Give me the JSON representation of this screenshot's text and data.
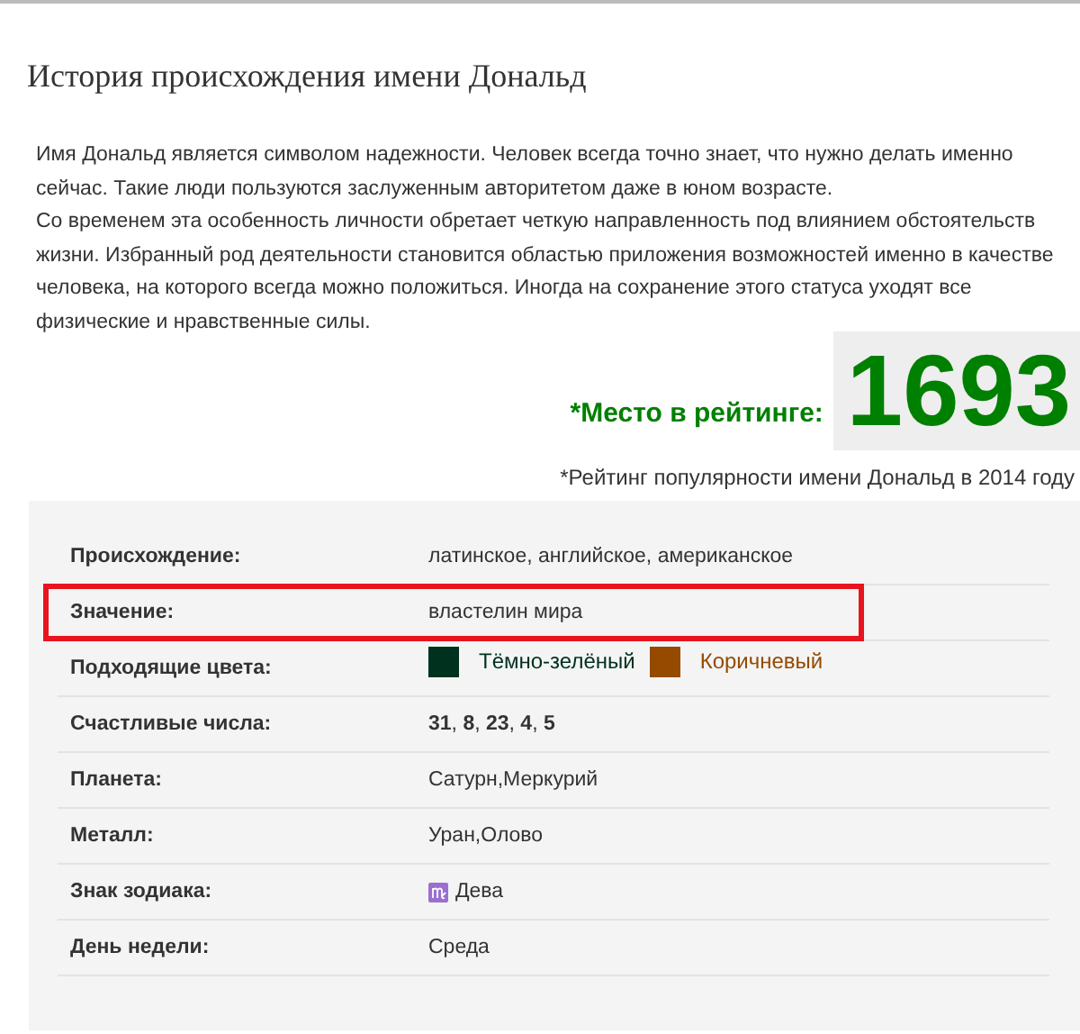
{
  "title": "История происхождения имени Дональд",
  "paragraphs": [
    "Имя Дональд является символом надежности. Человек всегда точно знает, что нужно делать именно сейчас. Такие люди пользуются заслуженным авторитетом даже в юном возрасте.",
    "Со временем эта особенность личности обретает четкую направленность под влиянием обстоятельств жизни. Избранный род деятельности становится областью приложения возможностей именно в качестве человека, на которого всегда можно положиться. Иногда на сохранение этого статуса уходят все физические и нравственные силы."
  ],
  "rating": {
    "label": "*Место в рейтинге:",
    "value": "1693",
    "note": "*Рейтинг популярности имени Дональд в 2014 году"
  },
  "rows": [
    {
      "kind": "text",
      "label": "Происхождение:",
      "value": "латинское, английское, американское",
      "highlighted": false
    },
    {
      "kind": "text",
      "label": "Значение:",
      "value": "властелин мира",
      "highlighted": true
    },
    {
      "kind": "colors",
      "label": "Подходящие цвета:",
      "colors": [
        {
          "label": "Тёмно-зелёный",
          "color": "#00311e"
        },
        {
          "label": "Коричневый",
          "color": "#954a00"
        }
      ],
      "highlighted": false
    },
    {
      "kind": "text",
      "label": "Счастливые числа:",
      "value": "**31**, **8**, **23**, **4**, **5**",
      "highlighted": false
    },
    {
      "kind": "text",
      "label": "Планета:",
      "value": "Сатурн,Меркурий",
      "highlighted": false
    },
    {
      "kind": "text",
      "label": "Металл:",
      "value": "Уран,Олово",
      "highlighted": false
    },
    {
      "kind": "zodiac",
      "label": "Знак зодиака:",
      "value": "Дева",
      "highlighted": false
    },
    {
      "kind": "text",
      "label": "День недели:",
      "value": "Среда",
      "highlighted": false
    }
  ]
}
